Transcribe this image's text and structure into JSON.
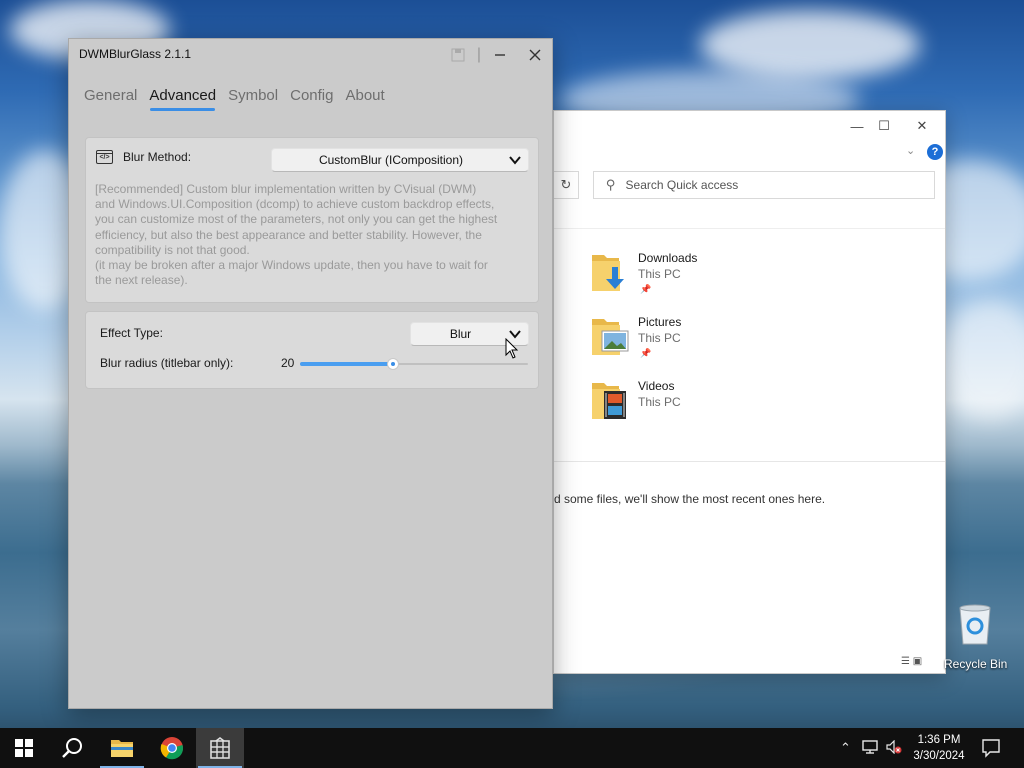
{
  "dwm": {
    "title": "DWMBlurGlass 2.1.1",
    "tabs": [
      {
        "label": "General",
        "active": false
      },
      {
        "label": "Advanced",
        "active": true
      },
      {
        "label": "Symbol",
        "active": false
      },
      {
        "label": "Config",
        "active": false
      },
      {
        "label": "About",
        "active": false
      }
    ],
    "blur_method": {
      "label": "Blur Method:",
      "value": "CustomBlur (IComposition)",
      "description": "[Recommended] Custom blur implementation written by CVisual (DWM)\nand Windows.UI.Composition (dcomp) to achieve custom backdrop effects,\nyou can customize most of the parameters, not only you can get the highest\nefficiency, but also the best appearance and better stability. However, the\ncompatibility is not that good.\n(it may be broken after a major Windows update, then you have to wait for\nthe next release)."
    },
    "effect_type": {
      "label": "Effect Type:",
      "value": "Blur"
    },
    "blur_radius": {
      "label": "Blur radius (titlebar only):",
      "value": "20",
      "fraction": 0.41
    }
  },
  "explorer": {
    "search_placeholder": "Search Quick access",
    "folders": [
      {
        "name": "Downloads",
        "location": "This PC",
        "pinned": true,
        "icon": "downloads-folder-icon"
      },
      {
        "name": "Pictures",
        "location": "This PC",
        "pinned": true,
        "icon": "pictures-folder-icon"
      },
      {
        "name": "Videos",
        "location": "This PC",
        "pinned": false,
        "icon": "videos-folder-icon"
      }
    ],
    "recent_empty_text": "d some files, we'll show the most recent ones here."
  },
  "desktop": {
    "recycle_bin_label": "Recycle Bin"
  },
  "taskbar": {
    "time": "1:36 PM",
    "date": "3/30/2024",
    "apps": [
      "start-icon",
      "search-icon",
      "file-explorer-icon",
      "chrome-icon",
      "dwmblurglass-icon"
    ]
  },
  "colors": {
    "accent": "#3a8ee6",
    "window_bg": "#cbcbcb",
    "card_bg": "#dadada",
    "taskbar": "#101010"
  }
}
